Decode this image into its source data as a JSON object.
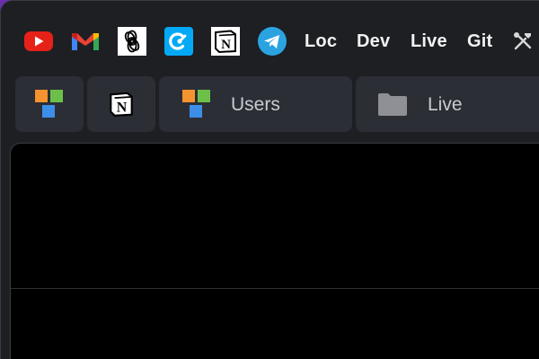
{
  "bookmarks": {
    "items": [
      {
        "icon": "youtube-icon"
      },
      {
        "icon": "gmail-icon"
      },
      {
        "icon": "openai-icon"
      },
      {
        "icon": "clockify-icon"
      },
      {
        "icon": "notion-icon"
      },
      {
        "icon": "telegram-icon"
      }
    ],
    "text_links": [
      "Loc",
      "Dev",
      "Live",
      "Git"
    ],
    "tools_icon": "tools-icon"
  },
  "tabs": [
    {
      "icon": "tiles-icon",
      "label": ""
    },
    {
      "icon": "notion-icon",
      "label": ""
    },
    {
      "icon": "tiles-icon",
      "label": "Users"
    },
    {
      "icon": "folder-icon",
      "label": "Live"
    }
  ],
  "colors": {
    "tile_orange": "#f5932e",
    "tile_green": "#6cc04a",
    "tile_blue": "#3d8ee8",
    "youtube_red": "#e62117",
    "telegram_blue": "#2aa3e0",
    "clockify_blue": "#03a9f4"
  }
}
